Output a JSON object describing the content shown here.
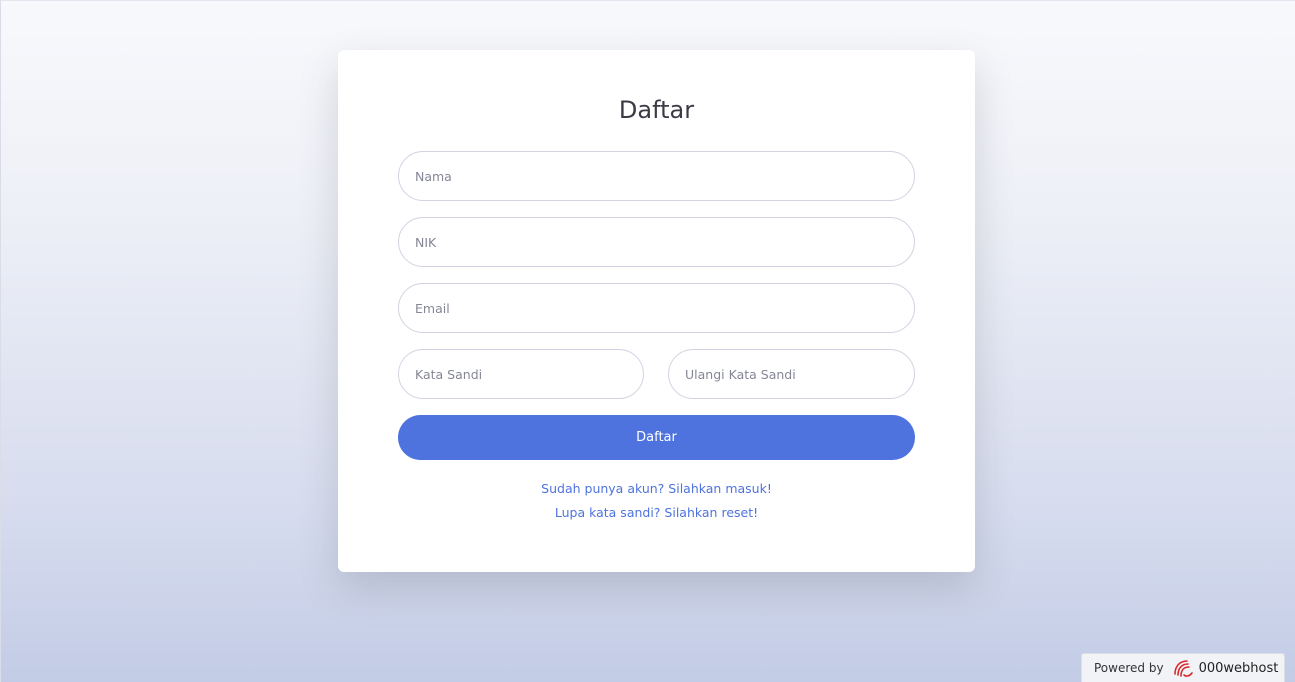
{
  "form": {
    "title": "Daftar",
    "fields": {
      "nama": {
        "placeholder": "Nama",
        "value": ""
      },
      "nik": {
        "placeholder": "NIK",
        "value": ""
      },
      "email": {
        "placeholder": "Email",
        "value": ""
      },
      "password": {
        "placeholder": "Kata Sandi",
        "value": ""
      },
      "repeat_password": {
        "placeholder": "Ulangi Kata Sandi",
        "value": ""
      }
    },
    "submit_label": "Daftar",
    "links": {
      "login": "Sudah punya akun? Silahkan masuk!",
      "reset": "Lupa kata sandi? Silahkan reset!"
    }
  },
  "footer": {
    "powered_by": "Powered by",
    "brand": "000webhost",
    "brand_icon": "000webhost-logo-icon"
  },
  "colors": {
    "accent": "#4e73df",
    "title_text": "#3a3b45",
    "input_border": "#d1d3e2",
    "logo_red": "#d6282b"
  }
}
